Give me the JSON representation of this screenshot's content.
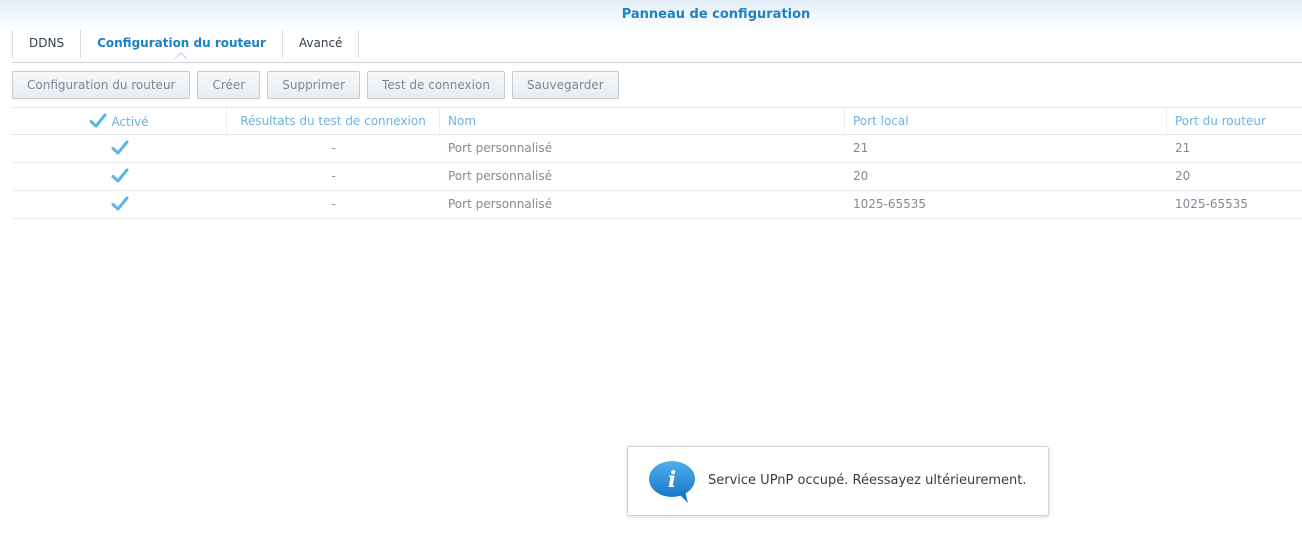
{
  "window": {
    "title": "Panneau de configuration"
  },
  "tabs": [
    {
      "label": "DDNS",
      "active": false
    },
    {
      "label": "Configuration du routeur",
      "active": true
    },
    {
      "label": "Avancé",
      "active": false
    }
  ],
  "toolbar": {
    "router_config": "Configuration du routeur",
    "create": "Créer",
    "delete": "Supprimer",
    "test": "Test de connexion",
    "save": "Sauvegarder"
  },
  "table": {
    "headers": {
      "enabled": "Activé",
      "test_results": "Résultats du test de connexion",
      "name": "Nom",
      "local_port": "Port local",
      "router_port": "Port du routeur"
    },
    "header_checked": true,
    "rows": [
      {
        "enabled": true,
        "test_result": "-",
        "name": "Port personnalisé",
        "local_port": "21",
        "router_port": "21"
      },
      {
        "enabled": true,
        "test_result": "-",
        "name": "Port personnalisé",
        "local_port": "20",
        "router_port": "20"
      },
      {
        "enabled": true,
        "test_result": "-",
        "name": "Port personnalisé",
        "local_port": "1025-65535",
        "router_port": "1025-65535"
      }
    ]
  },
  "toast": {
    "icon": "info-speech-bubble-icon",
    "message": "Service UPnP occupé. Réessayez ultérieurement."
  },
  "colors": {
    "accent": "#1a82c6",
    "check": "#5bb4e5",
    "header_text": "#6fb2e0"
  }
}
